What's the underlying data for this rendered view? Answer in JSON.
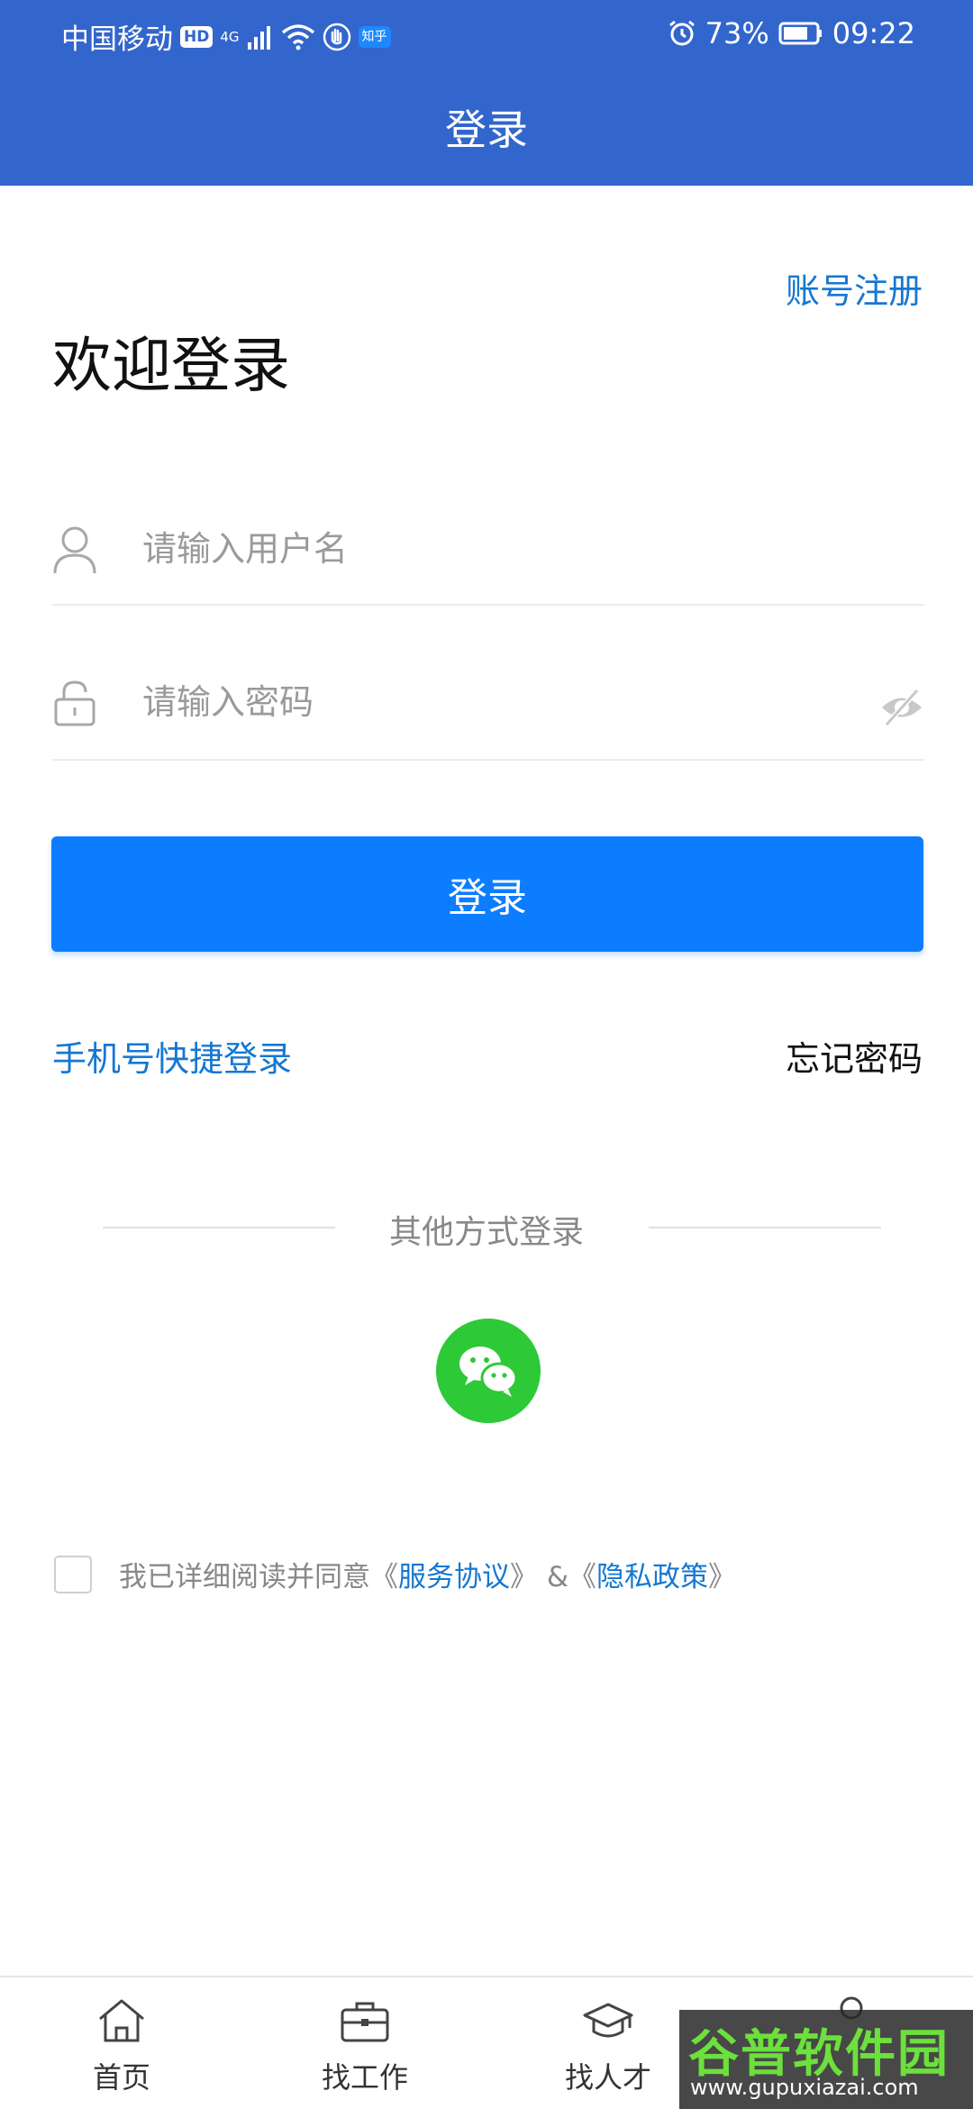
{
  "status_bar": {
    "carrier": "中国移动",
    "hd": "HD",
    "network": "4G",
    "app_badge": "知乎",
    "battery": "73%",
    "time": "09:22"
  },
  "header": {
    "title": "登录"
  },
  "register_link": "账号注册",
  "welcome": "欢迎登录",
  "username": {
    "placeholder": "请输入用户名",
    "value": ""
  },
  "password": {
    "placeholder": "请输入密码",
    "value": ""
  },
  "login_button": "登录",
  "quick_login": "手机号快捷登录",
  "forgot_password": "忘记密码",
  "other_login": "其他方式登录",
  "agreement": {
    "prefix": "我已详细阅读并同意",
    "open": "《",
    "service": "服务协议",
    "close": "》",
    "amp": " &《",
    "privacy": "隐私政策",
    "close2": "》"
  },
  "tabs": [
    {
      "label": "首页",
      "icon": "home-icon"
    },
    {
      "label": "找工作",
      "icon": "briefcase-icon"
    },
    {
      "label": "找人才",
      "icon": "graduation-cap-icon"
    },
    {
      "label": "",
      "icon": "user-icon"
    }
  ],
  "watermark": {
    "name": "谷普软件园",
    "url": "www.gupuxiazai.com"
  },
  "colors": {
    "header": "#3366cc",
    "primary_button": "#0d7dff",
    "link": "#1677d2",
    "wechat": "#2dc937"
  }
}
